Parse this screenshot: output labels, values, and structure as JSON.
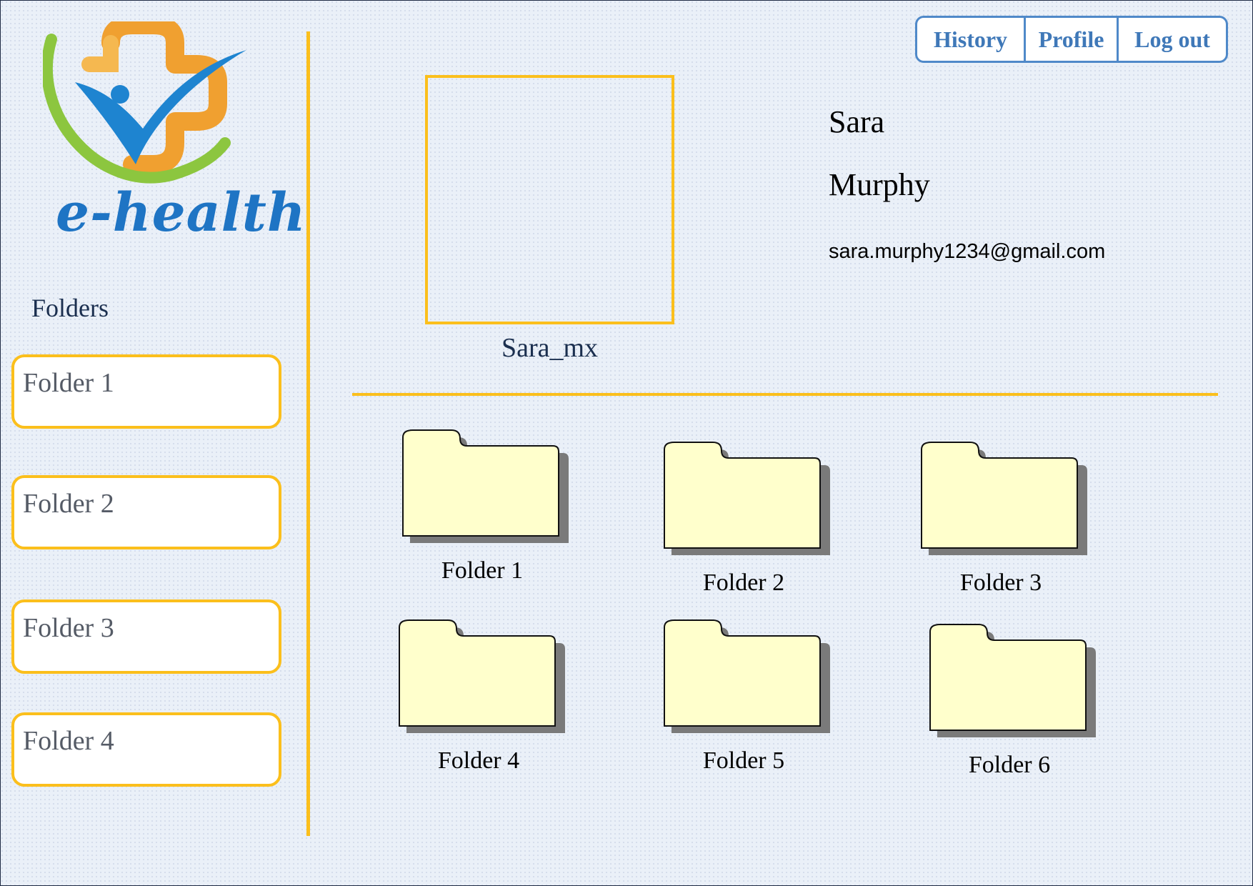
{
  "brand": {
    "name": "e-health",
    "colors": {
      "blue": "#1e74c4",
      "orange": "#f0a030",
      "green": "#8cc63f",
      "accent": "#fbbf1c"
    }
  },
  "nav": {
    "history": "History",
    "profile": "Profile",
    "logout": "Log out"
  },
  "sidebar": {
    "title": "Folders",
    "items": [
      {
        "label": "Folder 1"
      },
      {
        "label": "Folder 2"
      },
      {
        "label": "Folder 3"
      },
      {
        "label": "Folder 4"
      }
    ]
  },
  "profile": {
    "username": "Sara_mx",
    "first_name": "Sara",
    "last_name": "Murphy",
    "email": "sara.murphy1234@gmail.com"
  },
  "folders": {
    "icon": "folder-icon",
    "items": [
      {
        "label": "Folder 1"
      },
      {
        "label": "Folder 2"
      },
      {
        "label": "Folder 3"
      },
      {
        "label": "Folder 4"
      },
      {
        "label": "Folder 5"
      },
      {
        "label": "Folder 6"
      }
    ]
  }
}
